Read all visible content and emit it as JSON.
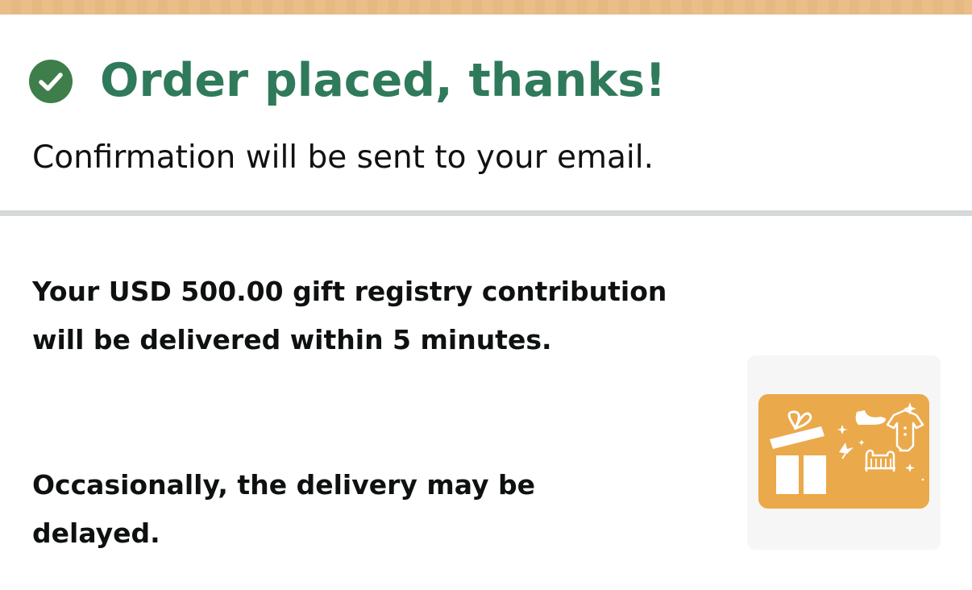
{
  "confirmation": {
    "title": "Order placed, thanks!",
    "subtitle": "Confirmation will be sent to your email."
  },
  "details": {
    "delivery_message": "Your USD 500.00 gift registry contribution will be delivered within 5 minutes.",
    "delay_notice": "Occasionally, the delivery may be delayed."
  },
  "gift_card": {
    "icons": [
      "gift-box-icon",
      "baby-shoe-icon",
      "baby-onesie-icon",
      "baby-crib-icon",
      "bird-icon",
      "sparkle-icon"
    ]
  },
  "colors": {
    "accent_green": "#2f7a5b",
    "check_badge": "#3d7e4a",
    "top_band": "#e9be88",
    "card_orange": "#eaa94b",
    "divider": "#d5d9d9"
  }
}
